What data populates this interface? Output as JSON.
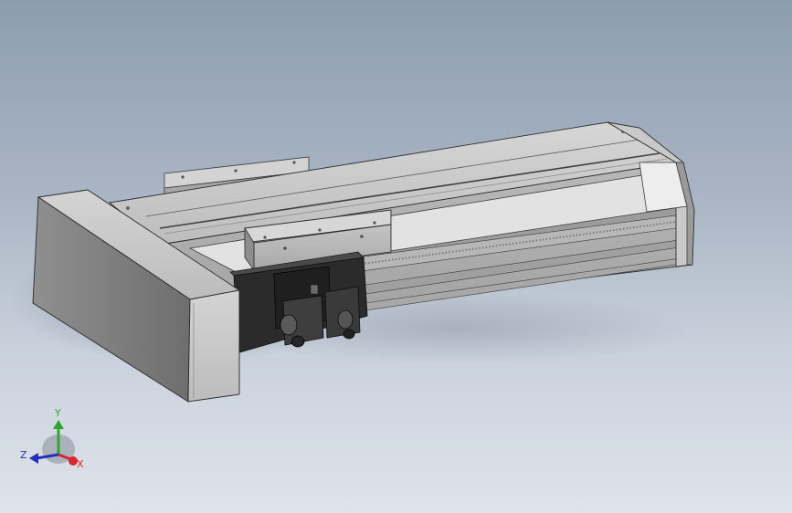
{
  "viewport": {
    "background_top": "#8d9db0",
    "background_bottom": "#dfe3ea"
  },
  "triad": {
    "x_label": "X",
    "y_label": "Y",
    "z_label": "Z",
    "x_color": "#d8262a",
    "y_color": "#2ea62e",
    "z_color": "#2430b8"
  }
}
